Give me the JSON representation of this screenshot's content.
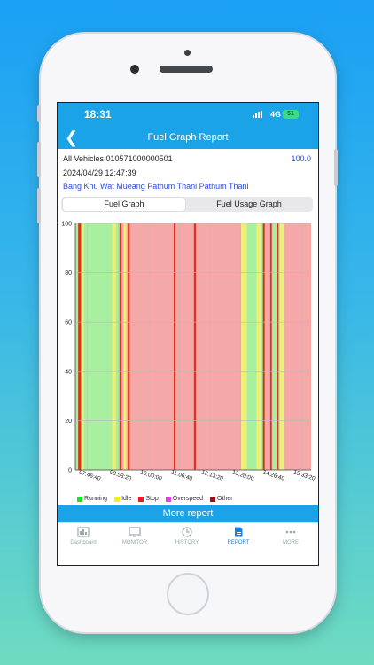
{
  "status_bar": {
    "time": "18:31",
    "network": "4G",
    "battery": "51"
  },
  "header": {
    "title": "Fuel Graph Report",
    "back_icon": "chevron-left-icon"
  },
  "vehicle": {
    "label": "All Vehicles 010571000000501",
    "speed": "100.0",
    "datetime": "2024/04/29 12:47:39",
    "location": "Bang Khu Wat Mueang Pathum Thani Pathum Thani"
  },
  "tabs": [
    {
      "label": "Fuel Graph",
      "active": true
    },
    {
      "label": "Fuel Usage Graph",
      "active": false
    }
  ],
  "colors": {
    "accent": "#1aa3e6",
    "running": "#a8f0a0",
    "idle": "#f0f070",
    "stop": "#f5a8a8",
    "stop_line": "#e03020",
    "overspeed": "#e040e0",
    "other": "#a01010"
  },
  "chart_data": {
    "type": "area",
    "title": "",
    "xlabel": "",
    "ylabel": "",
    "ylim": [
      0,
      100
    ],
    "y_ticks": [
      "0",
      "20",
      "40",
      "60",
      "80",
      "100"
    ],
    "x_ticks": [
      "07:46:40",
      "08:53:20",
      "10:00:00",
      "11:06:40",
      "12:13:20",
      "13:20:00",
      "14:26:40",
      "15:33:20"
    ],
    "x_range": [
      "07:20",
      "15:53"
    ],
    "series_name": "Fuel",
    "status_bands": [
      {
        "start": "07:20",
        "end": "07:27",
        "status": "Running"
      },
      {
        "start": "07:27",
        "end": "07:31",
        "status": "Stop"
      },
      {
        "start": "07:31",
        "end": "07:38",
        "status": "Idle"
      },
      {
        "start": "07:38",
        "end": "08:40",
        "status": "Running"
      },
      {
        "start": "08:40",
        "end": "08:48",
        "status": "Idle"
      },
      {
        "start": "08:48",
        "end": "08:56",
        "status": "Running"
      },
      {
        "start": "08:56",
        "end": "09:05",
        "status": "Stop"
      },
      {
        "start": "09:05",
        "end": "09:11",
        "status": "Idle"
      },
      {
        "start": "09:11",
        "end": "13:21",
        "status": "Stop"
      },
      {
        "start": "13:21",
        "end": "13:33",
        "status": "Idle"
      },
      {
        "start": "13:33",
        "end": "13:55",
        "status": "Running"
      },
      {
        "start": "13:55",
        "end": "14:03",
        "status": "Idle"
      },
      {
        "start": "14:03",
        "end": "14:13",
        "status": "Running"
      },
      {
        "start": "14:13",
        "end": "14:28",
        "status": "Stop"
      },
      {
        "start": "14:28",
        "end": "14:46",
        "status": "Running"
      },
      {
        "start": "14:46",
        "end": "14:54",
        "status": "Idle"
      },
      {
        "start": "14:54",
        "end": "15:53",
        "status": "Stop"
      }
    ],
    "stop_markers": [
      "07:28",
      "07:30",
      "08:58",
      "09:16",
      "10:56",
      "11:40",
      "14:10",
      "14:26",
      "14:40"
    ],
    "legend": [
      {
        "name": "Running",
        "color": "#22dd22"
      },
      {
        "name": "Idle",
        "color": "#f0f020"
      },
      {
        "name": "Stop",
        "color": "#e02020"
      },
      {
        "name": "Overspeed",
        "color": "#e040e0"
      },
      {
        "name": "Other",
        "color": "#a01010"
      }
    ]
  },
  "more_report_label": "More report",
  "tabbar": [
    {
      "label": "Dashboard",
      "icon": "dashboard-icon",
      "active": false
    },
    {
      "label": "MONITOR",
      "icon": "monitor-icon",
      "active": false
    },
    {
      "label": "HISTORY",
      "icon": "history-icon",
      "active": false
    },
    {
      "label": "REPORT",
      "icon": "report-icon",
      "active": true
    },
    {
      "label": "MORE",
      "icon": "more-icon",
      "active": false
    }
  ]
}
